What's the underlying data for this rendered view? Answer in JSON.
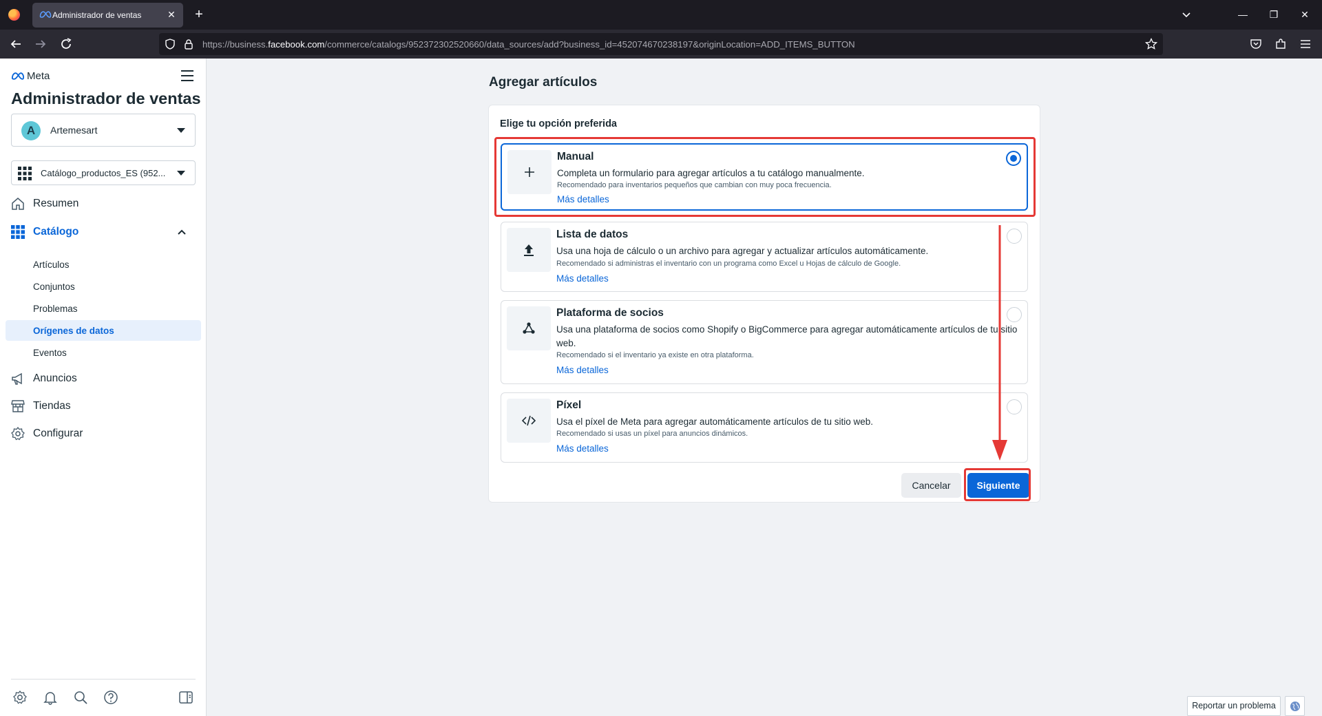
{
  "browser": {
    "tab_title": "Administrador de ventas",
    "url_prefix": "https://business.",
    "url_domain": "facebook.com",
    "url_suffix": "/commerce/catalogs/952372302520660/data_sources/add?business_id=452074670238197&originLocation=ADD_ITEMS_BUTTON"
  },
  "sidebar": {
    "logo_text": "Meta",
    "app_title": "Administrador de ventas",
    "account": {
      "initial": "A",
      "name": "Artemesart"
    },
    "catalog": {
      "name": "Catálogo_productos_ES (952..."
    },
    "nav": {
      "summary": "Resumen",
      "catalog": "Catálogo",
      "ads": "Anuncios",
      "stores": "Tiendas",
      "settings": "Configurar"
    },
    "catalog_items": [
      "Artículos",
      "Conjuntos",
      "Problemas",
      "Orígenes de datos",
      "Eventos"
    ],
    "active_catalog_item": "Orígenes de datos"
  },
  "main": {
    "page_title": "Agregar artículos",
    "card_title": "Elige tu opción preferida",
    "options": [
      {
        "title": "Manual",
        "description": "Completa un formulario para agregar artículos a tu catálogo manualmente.",
        "recommendation": "Recomendado para inventarios pequeños que cambian con muy poca frecuencia.",
        "link": "Más detalles",
        "selected": true,
        "icon": "plus-icon"
      },
      {
        "title": "Lista de datos",
        "description": "Usa una hoja de cálculo o un archivo para agregar y actualizar artículos automáticamente.",
        "recommendation": "Recomendado si administras el inventario con un programa como Excel u Hojas de cálculo de Google.",
        "link": "Más detalles",
        "selected": false,
        "icon": "upload-icon"
      },
      {
        "title": "Plataforma de socios",
        "description": "Usa una plataforma de socios como Shopify o BigCommerce para agregar automáticamente artículos de tu sitio web.",
        "recommendation": "Recomendado si el inventario ya existe en otra plataforma.",
        "link": "Más detalles",
        "selected": false,
        "icon": "partner-network-icon"
      },
      {
        "title": "Píxel",
        "description": "Usa el píxel de Meta para agregar automáticamente artículos de tu sitio web.",
        "recommendation": "Recomendado si usas un píxel para anuncios dinámicos.",
        "link": "Más detalles",
        "selected": false,
        "icon": "code-icon"
      }
    ],
    "cancel_label": "Cancelar",
    "next_label": "Siguiente"
  },
  "footer": {
    "report_label": "Reportar un problema"
  },
  "colors": {
    "accent": "#0a66d8",
    "annotation": "#e53935"
  }
}
